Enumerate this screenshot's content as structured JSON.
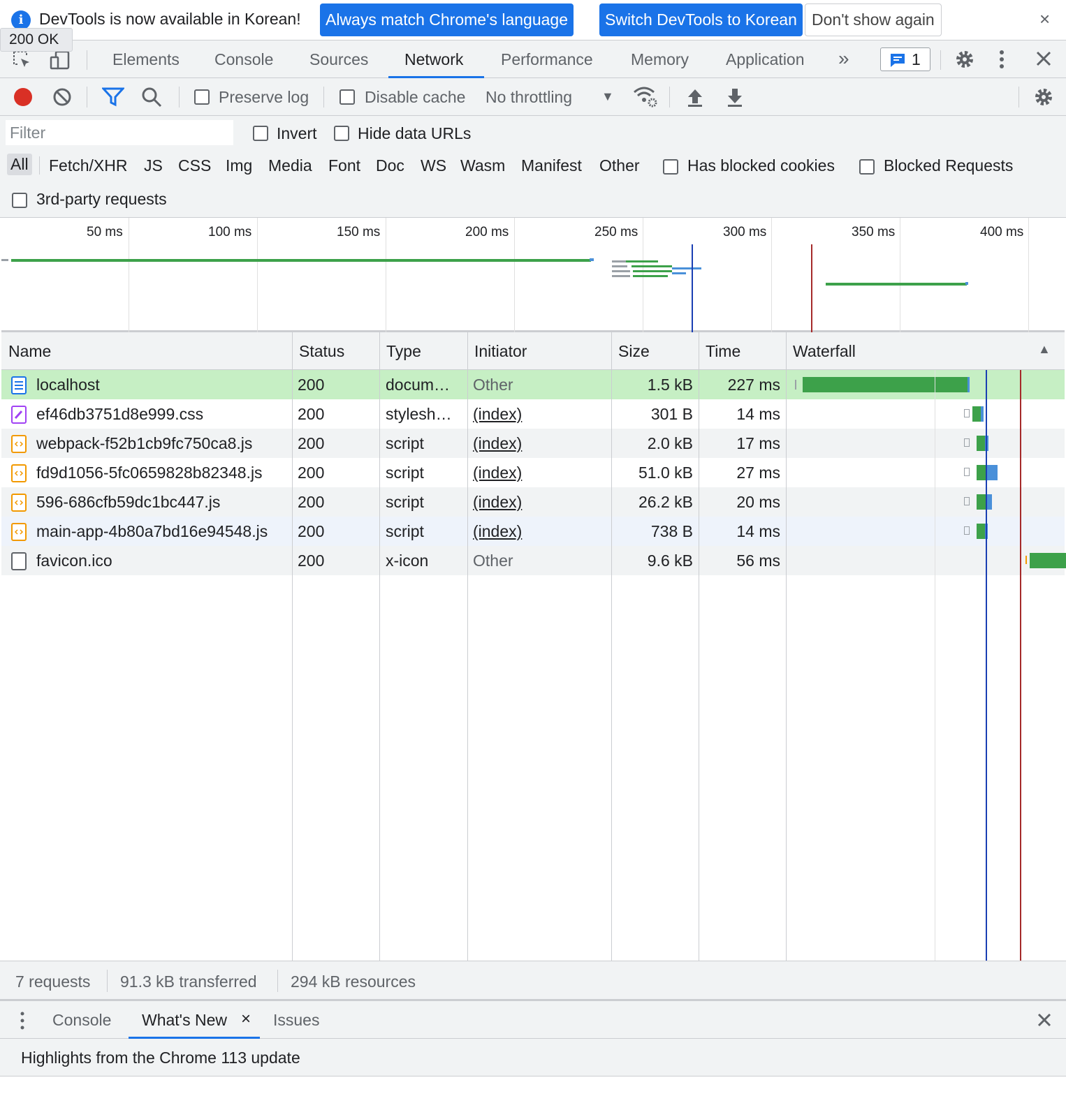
{
  "infobar": {
    "message": "DevTools is now available in Korean!",
    "btn_match": "Always match Chrome's language",
    "btn_switch": "Switch DevTools to Korean",
    "btn_dismiss": "Don't show again",
    "close": "×"
  },
  "tooltip": "200 OK",
  "main_tabs": [
    "Elements",
    "Console",
    "Sources",
    "Network",
    "Performance",
    "Memory",
    "Application"
  ],
  "more_tabs": "»",
  "issues_count": "1",
  "toolbar": {
    "preserve_log": "Preserve log",
    "disable_cache": "Disable cache",
    "throttling": "No throttling",
    "throttling_arrow": "▼"
  },
  "filter": {
    "placeholder": "Filter",
    "invert": "Invert",
    "hide_data_urls": "Hide data URLs",
    "types": [
      "All",
      "Fetch/XHR",
      "JS",
      "CSS",
      "Img",
      "Media",
      "Font",
      "Doc",
      "WS",
      "Wasm",
      "Manifest",
      "Other"
    ],
    "has_blocked_cookies": "Has blocked cookies",
    "blocked_requests": "Blocked Requests",
    "third_party": "3rd-party requests"
  },
  "overview": {
    "ticks": [
      "50 ms",
      "100 ms",
      "150 ms",
      "200 ms",
      "250 ms",
      "300 ms",
      "350 ms",
      "400 ms"
    ]
  },
  "table": {
    "headers": [
      "Name",
      "Status",
      "Type",
      "Initiator",
      "Size",
      "Time",
      "Waterfall"
    ],
    "sort_indicator": "▲",
    "rows": [
      {
        "name": "localhost",
        "status": "200",
        "type": "docum…",
        "initiator": "Other",
        "size": "1.5 kB",
        "time": "227 ms",
        "kind": "doc"
      },
      {
        "name": "ef46db3751d8e999.css",
        "status": "200",
        "type": "stylesh…",
        "initiator": "(index)",
        "size": "301 B",
        "time": "14 ms",
        "kind": "css"
      },
      {
        "name": "webpack-f52b1cb9fc750ca8.js",
        "status": "200",
        "type": "script",
        "initiator": "(index)",
        "size": "2.0 kB",
        "time": "17 ms",
        "kind": "js"
      },
      {
        "name": "fd9d1056-5fc0659828b82348.js",
        "status": "200",
        "type": "script",
        "initiator": "(index)",
        "size": "51.0 kB",
        "time": "27 ms",
        "kind": "js"
      },
      {
        "name": "596-686cfb59dc1bc447.js",
        "status": "200",
        "type": "script",
        "initiator": "(index)",
        "size": "26.2 kB",
        "time": "20 ms",
        "kind": "js"
      },
      {
        "name": "main-app-4b80a7bd16e94548.js",
        "status": "200",
        "type": "script",
        "initiator": "(index)",
        "size": "738 B",
        "time": "14 ms",
        "kind": "js"
      },
      {
        "name": "favicon.ico",
        "status": "200",
        "type": "x-icon",
        "initiator": "Other",
        "size": "9.6 kB",
        "time": "56 ms",
        "kind": "other"
      }
    ]
  },
  "status": {
    "requests": "7 requests",
    "transferred": "91.3 kB transferred",
    "resources": "294 kB resources"
  },
  "drawer": {
    "tabs": [
      "Console",
      "What's New",
      "Issues"
    ],
    "tab_close": "×",
    "highlight": "Highlights from the Chrome 113 update"
  },
  "colors": {
    "accent": "#1a73e8",
    "record": "#d93025",
    "waiting_green": "#3da14a",
    "download_blue": "#4a90d9",
    "selected_row": "#c6efc4",
    "dom_line": "#1a3fb3",
    "load_line": "#a52a2a"
  }
}
